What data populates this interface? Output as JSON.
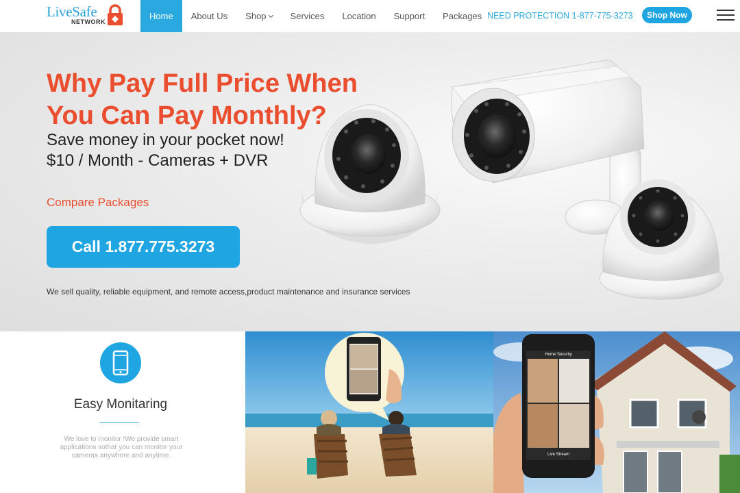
{
  "brand": {
    "name": "LiveSafe",
    "sub": "NETWORK"
  },
  "nav": {
    "items": [
      {
        "label": "Home",
        "active": true
      },
      {
        "label": "About Us"
      },
      {
        "label": "Shop",
        "dropdown": true
      },
      {
        "label": "Services"
      },
      {
        "label": "Location"
      },
      {
        "label": "Support"
      },
      {
        "label": "Packages"
      }
    ],
    "protect": "NEED PROTECTION 1-877-775-3273",
    "shop_now": "Shop Now",
    "menu_icon": "hamburger-icon"
  },
  "hero": {
    "title": "Why Pay Full Price When You Can Pay Monthly?",
    "line1": "Save money in your pocket now!",
    "line2": "$10 / Month - Cameras + DVR",
    "compare": "Compare Packages",
    "call": "Call 1.877.775.3273",
    "note": "We sell quality, reliable equipment, and remote access,product maintenance and insurance services"
  },
  "feature": {
    "icon": "mobile-phone-icon",
    "title": "Easy Monitaring",
    "text": "We love to monitor !We provide smart applications sothat you can monitor your cameras anywhere and anytime."
  },
  "phone_screen": {
    "top": "Home Security",
    "bottom": "Live Stream"
  },
  "colors": {
    "accent": "#1fa6e2",
    "brand_red": "#ea4e2e"
  }
}
